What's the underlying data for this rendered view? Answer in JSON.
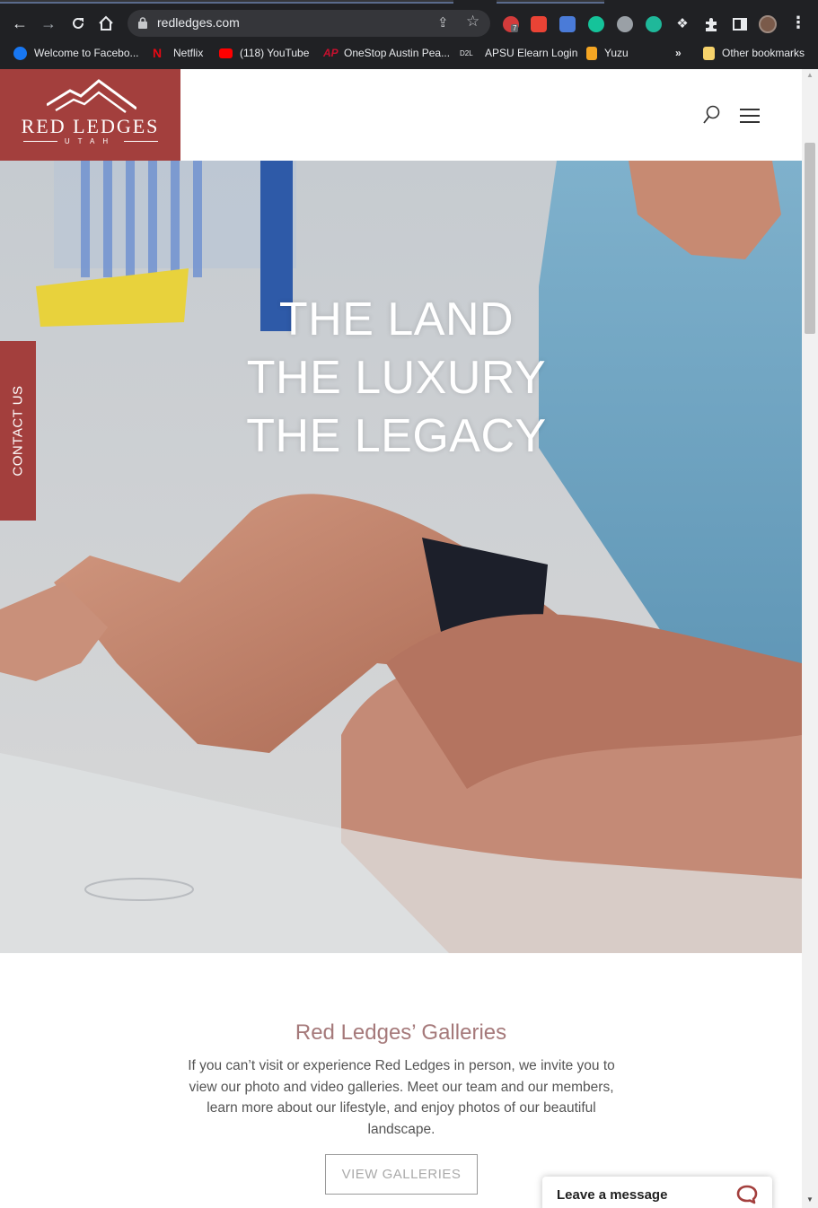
{
  "browser": {
    "url": "redledges.com",
    "bookmarks": [
      {
        "label": "Welcome to Facebo...",
        "icon": "facebook-icon",
        "color": "#1877f2"
      },
      {
        "label": "Netflix",
        "icon": "netflix-icon",
        "color": "#e50914"
      },
      {
        "label": "(118) YouTube",
        "icon": "youtube-icon",
        "color": "#ff0000"
      },
      {
        "label": "OneStop Austin Pea...",
        "icon": "onestop-icon",
        "color": "#c8102e"
      },
      {
        "label": "APSU Elearn Login",
        "icon": "d2l-icon",
        "color": "#e8eaed"
      },
      {
        "label": "Yuzu",
        "icon": "yuzu-icon",
        "color": "#f5a623"
      }
    ],
    "overflow_chevron": "»",
    "other_bookmarks": "Other bookmarks",
    "extensions": [
      {
        "name": "adblock-icon",
        "badge": "7",
        "color": "#d33b3b"
      },
      {
        "name": "gmail-icon",
        "color": "#ea4335"
      },
      {
        "name": "camera-icon",
        "color": "#4a7bd8"
      },
      {
        "name": "grammarly-icon",
        "color": "#15c39a"
      },
      {
        "name": "extension-hex-icon",
        "color": "#9aa0a6"
      },
      {
        "name": "amazon-assistant-icon",
        "color": "#1fb89a"
      },
      {
        "name": "dropbox-icon",
        "color": "#e8eaed"
      },
      {
        "name": "puzzle-icon",
        "color": "#e8eaed"
      },
      {
        "name": "sidepanel-icon",
        "color": "#e8eaed"
      }
    ]
  },
  "site": {
    "logo_name": "RED LEDGES",
    "logo_sub": "UTAH",
    "brand_color": "#a33f3d",
    "contact_tab": "CONTACT US",
    "hero_lines": [
      "THE LAND",
      "THE LUXURY",
      "THE LEGACY"
    ],
    "galleries": {
      "title": "Red Ledges’ Galleries",
      "body": "If you can’t visit or experience Red Ledges in person, we invite you to view our photo and video galleries. Meet our team and our members, learn more about our lifestyle, and enjoy photos of our beautiful landscape.",
      "button": "VIEW GALLERIES"
    },
    "chat": {
      "label": "Leave a message"
    }
  }
}
